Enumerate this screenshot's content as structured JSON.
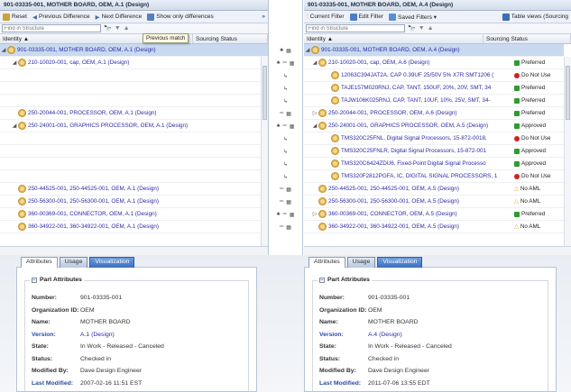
{
  "left": {
    "title": "901-03335-001, MOTHER BOARD, OEM, A.1 (Design)",
    "toolbar": {
      "reset": "Reset",
      "prev": "Previous Difference",
      "next": "Next Difference",
      "show_diff": "Show only differences",
      "more": "»"
    },
    "find_placeholder": "Find in Structure",
    "headers": {
      "identity": "Identity ▲",
      "sourcing": "Sourcing Status"
    },
    "tooltip": "Previous match",
    "rows": [
      {
        "label": "901-03335-001, MOTHER BOARD, OEM, A.1 (Design)"
      },
      {
        "label": "210-10020-001, cap, OEM, A.1 (Design)"
      },
      {
        "label": ""
      },
      {
        "label": ""
      },
      {
        "label": ""
      },
      {
        "label": "250-20044-001, PROCESSOR, OEM, A.1 (Design)"
      },
      {
        "label": "250-24001-001, GRAPHICS PROCESSOR, OEM, A.1 (Design)"
      },
      {
        "label": ""
      },
      {
        "label": ""
      },
      {
        "label": ""
      },
      {
        "label": ""
      },
      {
        "label": "250-44525-001, 250-44525-001, OEM, A.1 (Design)"
      },
      {
        "label": "250-56300-001, 250-56300-001, OEM, A.1 (Design)"
      },
      {
        "label": "360-00369-001, CONNECTOR, OEM, A.1 (Design)"
      },
      {
        "label": "360-34922-001, 360-34922-001, OEM, A.1 (Design)"
      }
    ]
  },
  "right": {
    "title": "901-03335-001, MOTHER BOARD, OEM, A.4 (Design)",
    "toolbar": {
      "current_filter": "Current Filter",
      "edit_filter": "Edit Filter",
      "saved_filters": "Saved Filters ▾",
      "table_views": "Table views (Sourcing"
    },
    "find_placeholder": "Find in Structure",
    "headers": {
      "identity": "Identity ▲",
      "sourcing": "Sourcing Status"
    },
    "rows": [
      {
        "label": "901-03335-001, MOTHER BOARD, OEM, A.4 (Design)",
        "status": ""
      },
      {
        "label": "210-10020-001, cap, OEM, A.6 (Design)",
        "status": "Preferred"
      },
      {
        "label": "12063C394JAT2A, CAP 0.39UF 25/50V 5% X7R SMT1206 (",
        "status": "Do Not Use"
      },
      {
        "label": "TAJE157M020RNJ, CAP, TANT, 150UF, 20%, 20V, SMT, 34",
        "status": "Preferred"
      },
      {
        "label": "TAJW106K025RNJ, CAP, TANT, 10UF, 10%, 25V, SMT, 34-",
        "status": "Preferred"
      },
      {
        "label": "250-20044-001, PROCESSOR, OEM, A.6 (Design)",
        "status": "Preferred"
      },
      {
        "label": "250-24001-001, GRAPHICS PROCESSOR, OEM, A.5 (Design)",
        "status": "Approved"
      },
      {
        "label": "TMS320C25FNL, Digital Signal Processors, 15-872-0018,",
        "status": "Do Not Use"
      },
      {
        "label": "TMS320C25FNLR, Digital Signal Processors, 15-872-001",
        "status": "Approved"
      },
      {
        "label": "TMS320C6424ZDU6, Fixed-Point Digital Signal Processo",
        "status": "Approved"
      },
      {
        "label": "TMS320F2812PGFA, IC, DIGITAL SIGNAL PROCESSORS, 1",
        "status": "Do Not Use"
      },
      {
        "label": "250-44525-001, 250-44525-001, OEM, A.5 (Design)",
        "status": "No AML"
      },
      {
        "label": "250-56300-001, 250-56300-001, OEM, A.5 (Design)",
        "status": "No AML"
      },
      {
        "label": "360-00369-001, CONNECTOR, OEM, A.5 (Design)",
        "status": "Preferred"
      },
      {
        "label": "360-34922-001, 360-34922-001, OEM, A.5 (Design)",
        "status": "No AML"
      }
    ]
  },
  "tabs": [
    "Attributes",
    "Usage",
    "Visualization"
  ],
  "section_title": "Part Attributes",
  "attr_labels": [
    "Number:",
    "Organization ID:",
    "Name:",
    "Version:",
    "State:",
    "Status:",
    "Modified By:",
    "Last Modified:"
  ],
  "attrs_left": [
    "901-03335-001",
    "OEM",
    "MOTHER BOARD",
    "A.1 (Design)",
    "In Work - Released - Canceled",
    "Checked in",
    "Dave Design Engineer",
    "2007-02-16 11:51 EST"
  ],
  "attrs_right": [
    "901-03335-001",
    "OEM",
    "MOTHER BOARD",
    "A.4 (Design)",
    "In Work - Released - Canceled",
    "Checked in",
    "Dave Design Engineer",
    "2011-07-06 13:55 EDT"
  ],
  "colors": {
    "preferred": "#2e9b2e",
    "do_not_use": "#d42020",
    "approved": "#2e9b2e",
    "no_aml": "#e0a020"
  }
}
